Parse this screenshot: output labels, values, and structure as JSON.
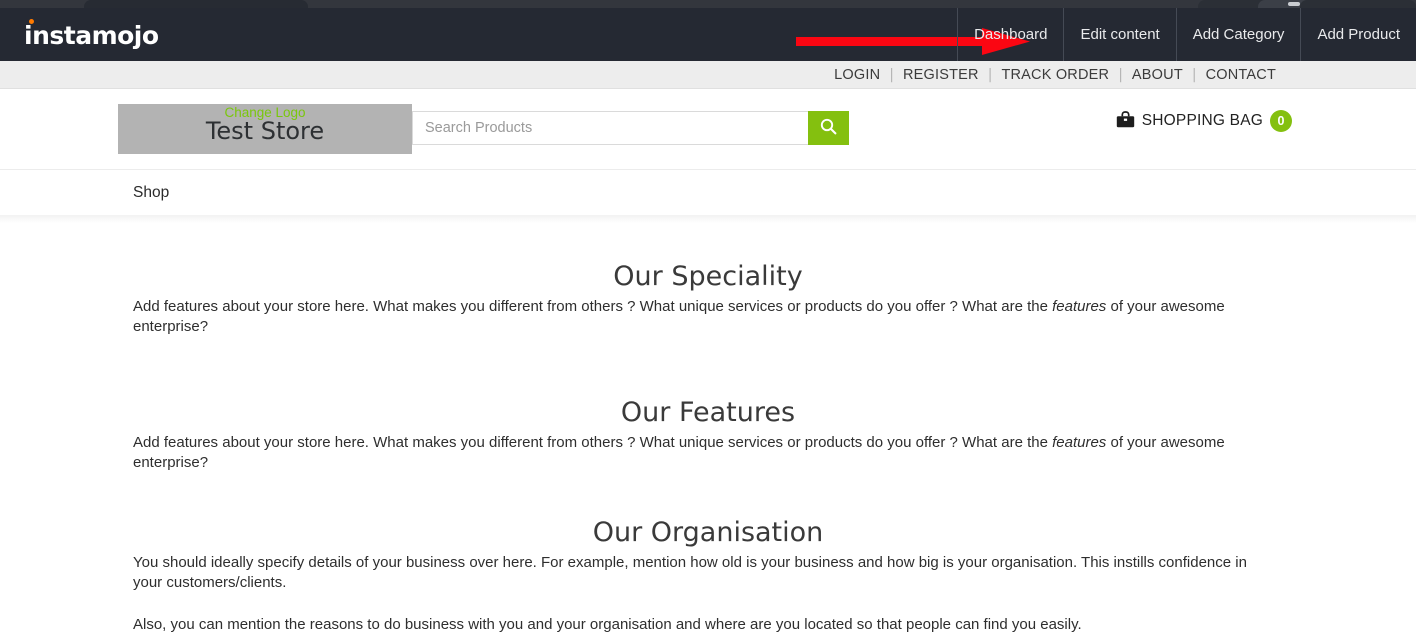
{
  "browser": {
    "chrome_visible": true
  },
  "admin_bar": {
    "logo_text": "instamojo",
    "logo_dot_color": "#ff7a00",
    "background_color": "#252933",
    "nav_items": [
      {
        "label": "Dashboard",
        "name": "dashboard"
      },
      {
        "label": "Edit content",
        "name": "edit-content"
      },
      {
        "label": "Add Category",
        "name": "add-category"
      },
      {
        "label": "Add Product",
        "name": "add-product"
      }
    ],
    "annotation": {
      "type": "red-arrow",
      "color": "#fb0612",
      "points_to": "Dashboard"
    }
  },
  "utility_bar": {
    "background_color": "#ededed",
    "links": [
      {
        "label": "LOGIN",
        "name": "login"
      },
      {
        "label": "REGISTER",
        "name": "register"
      },
      {
        "label": "TRACK ORDER",
        "name": "track-order"
      },
      {
        "label": "ABOUT",
        "name": "about"
      },
      {
        "label": "CONTACT",
        "name": "contact"
      }
    ],
    "separator": "|"
  },
  "store_header": {
    "logo": {
      "change_logo_label": "Change Logo",
      "change_logo_color": "#7ac70c",
      "store_name": "Test Store",
      "placeholder_background": "#b3b3b3"
    },
    "search": {
      "placeholder": "Search Products",
      "value": "",
      "button_icon": "search-icon",
      "button_color": "#84c00f"
    },
    "cart": {
      "icon": "shopping-bag-icon",
      "label": "SHOPPING BAG",
      "count": "0",
      "badge_color": "#84c00f"
    }
  },
  "shop_nav": {
    "items": [
      {
        "label": "Shop",
        "name": "shop"
      }
    ]
  },
  "content": {
    "sections": [
      {
        "title": "Our Speciality",
        "body_lead": "Add features about your store here. What makes you different from others ? What unique services or products do you offer ? What are the ",
        "body_em": "features",
        "body_tail": " of your awesome enterprise?"
      },
      {
        "title": "Our Features",
        "body_lead": "Add features about your store here. What makes you different from others ? What unique services or products do you offer ? What are the ",
        "body_em": "features",
        "body_tail": " of your awesome enterprise?"
      },
      {
        "title": "Our Organisation",
        "body_p1": "You should ideally specify details of your business over here. For example, mention how old is your business and how big is your organisation. This instills confidence in your customers/clients.",
        "body_p2": "Also, you can mention the reasons to do business with you and your organisation and where are you located so that people can find you easily."
      }
    ]
  }
}
